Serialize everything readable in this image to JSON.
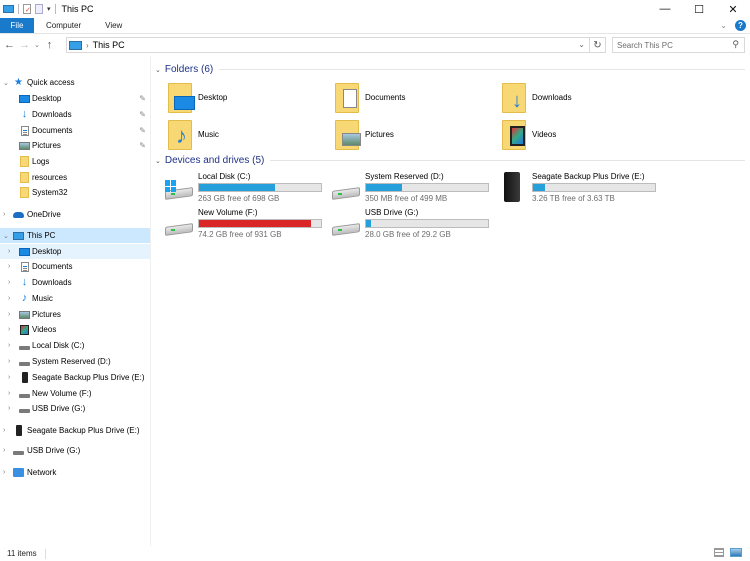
{
  "window": {
    "title": "This PC",
    "controls": {
      "minimize": "—",
      "maximize": "☐",
      "close": "✕"
    }
  },
  "ribbon": {
    "tabs": [
      {
        "label": "File",
        "active": true
      },
      {
        "label": "Computer",
        "active": false
      },
      {
        "label": "View",
        "active": false
      }
    ],
    "help": "?",
    "expand": "⌄"
  },
  "navbar": {
    "back": "←",
    "forward": "→",
    "recent": "⌄",
    "up": "↑",
    "breadcrumb": [
      "This PC"
    ],
    "crumb_separator": "›",
    "dropdown": "⌄",
    "refresh": "↻",
    "search_placeholder": "Search This PC",
    "search_icon": "⚲"
  },
  "navpane": {
    "items": [
      {
        "label": "Quick access",
        "icon": "star-icon",
        "expander": "⌄",
        "level": 0
      },
      {
        "label": "Desktop",
        "icon": "desktop-icon",
        "pinned": true,
        "level": 1
      },
      {
        "label": "Downloads",
        "icon": "downloads-icon",
        "pinned": true,
        "level": 1
      },
      {
        "label": "Documents",
        "icon": "documents-icon",
        "pinned": true,
        "level": 1
      },
      {
        "label": "Pictures",
        "icon": "pictures-icon",
        "pinned": true,
        "level": 1
      },
      {
        "label": "Logs",
        "icon": "folder-icon",
        "level": 1
      },
      {
        "label": "resources",
        "icon": "folder-icon",
        "level": 1
      },
      {
        "label": "System32",
        "icon": "folder-icon",
        "level": 1
      },
      {
        "label": "OneDrive",
        "icon": "onedrive-icon",
        "expander": "›",
        "level": 0
      },
      {
        "label": "This PC",
        "icon": "this-pc-icon",
        "expander": "⌄",
        "level": 0,
        "selected": true
      },
      {
        "label": "Desktop",
        "icon": "desktop-icon",
        "expander": "›",
        "level": 1,
        "hover": true
      },
      {
        "label": "Documents",
        "icon": "documents-icon",
        "expander": "›",
        "level": 1
      },
      {
        "label": "Downloads",
        "icon": "downloads-icon",
        "expander": "›",
        "level": 1
      },
      {
        "label": "Music",
        "icon": "music-icon",
        "expander": "›",
        "level": 1
      },
      {
        "label": "Pictures",
        "icon": "pictures-icon",
        "expander": "›",
        "level": 1
      },
      {
        "label": "Videos",
        "icon": "videos-icon",
        "expander": "›",
        "level": 1
      },
      {
        "label": "Local Disk (C:)",
        "icon": "drive-icon",
        "expander": "›",
        "level": 1
      },
      {
        "label": "System Reserved (D:)",
        "icon": "drive-icon",
        "expander": "›",
        "level": 1
      },
      {
        "label": "Seagate Backup Plus Drive (E:)",
        "icon": "external-drive-icon",
        "expander": "›",
        "level": 1
      },
      {
        "label": "New Volume (F:)",
        "icon": "drive-icon",
        "expander": "›",
        "level": 1
      },
      {
        "label": "USB Drive (G:)",
        "icon": "drive-icon",
        "expander": "›",
        "level": 1
      },
      {
        "label": "Seagate Backup Plus Drive (E:)",
        "icon": "external-drive-icon",
        "expander": "›",
        "level": 0
      },
      {
        "label": "USB Drive (G:)",
        "icon": "drive-icon",
        "expander": "›",
        "level": 0
      },
      {
        "label": "Network",
        "icon": "network-icon",
        "expander": "›",
        "level": 0
      }
    ],
    "pin_glyph": "📌"
  },
  "content": {
    "folders_header": "Folders (6)",
    "folders": [
      {
        "name": "Desktop",
        "icon": "desktop-folder-icon"
      },
      {
        "name": "Documents",
        "icon": "documents-folder-icon"
      },
      {
        "name": "Downloads",
        "icon": "downloads-folder-icon"
      },
      {
        "name": "Music",
        "icon": "music-folder-icon"
      },
      {
        "name": "Pictures",
        "icon": "pictures-folder-icon"
      },
      {
        "name": "Videos",
        "icon": "videos-folder-icon"
      }
    ],
    "drives_header": "Devices and drives (5)",
    "drives": [
      {
        "name": "Local Disk (C:)",
        "free": "263 GB free of 698 GB",
        "used_fraction": 0.623,
        "warning": false,
        "type": "system"
      },
      {
        "name": "System Reserved (D:)",
        "free": "350 MB free of 499 MB",
        "used_fraction": 0.299,
        "warning": false,
        "type": "hdd"
      },
      {
        "name": "Seagate Backup Plus Drive (E:)",
        "free": "3.26 TB free of 3.63 TB",
        "used_fraction": 0.102,
        "warning": false,
        "type": "external"
      },
      {
        "name": "New Volume (F:)",
        "free": "74.2 GB free of 931 GB",
        "used_fraction": 0.92,
        "warning": true,
        "type": "hdd"
      },
      {
        "name": "USB Drive (G:)",
        "free": "28.0 GB free of 29.2 GB",
        "used_fraction": 0.041,
        "warning": false,
        "type": "hdd"
      }
    ]
  },
  "statusbar": {
    "count": "11 items"
  },
  "colors": {
    "accent": "#1979ca",
    "bar_normal": "#26a0da",
    "bar_warning": "#da2626",
    "selected": "#cce8ff",
    "header": "#1e3287"
  }
}
